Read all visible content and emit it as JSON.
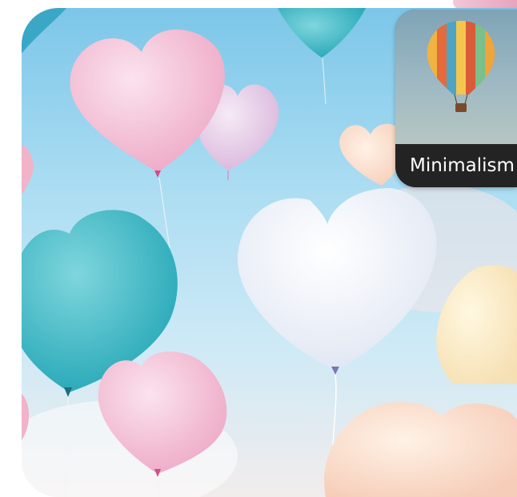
{
  "main_image": {
    "subject": "heart-shaped-fluffy-balloons-in-sky",
    "colors": {
      "sky_top": "#7cc6e8",
      "pink": "#f3c3d8",
      "teal": "#3fb8c6",
      "white": "#f4f6fb",
      "peach": "#f7d6c8"
    }
  },
  "style_card": {
    "label": "Minimalism",
    "thumbnail_subject": "hot-air-balloon"
  }
}
